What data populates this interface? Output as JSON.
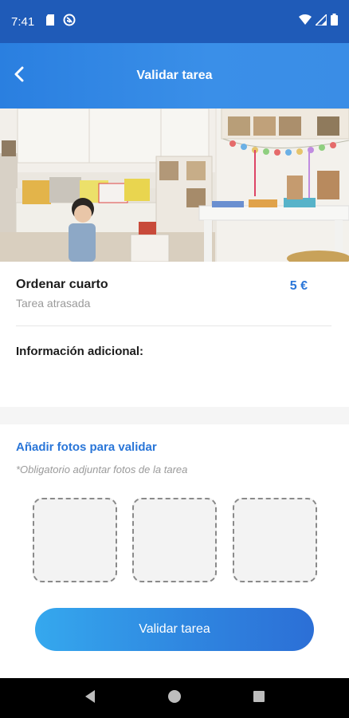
{
  "status_bar": {
    "time": "7:41",
    "left_icons": [
      "sd-card-icon",
      "no-tracking-icon"
    ],
    "right_icons": [
      "wifi-icon",
      "signal-icon",
      "battery-icon"
    ]
  },
  "app_bar": {
    "title": "Validar tarea",
    "back_icon": "chevron-left-icon"
  },
  "task": {
    "name": "Ordenar cuarto",
    "status": "Tarea atrasada",
    "price": "5 €",
    "additional_info_label": "Información adicional:"
  },
  "photos": {
    "title": "Añadir fotos para validar",
    "note": "*Obligatorio adjuntar fotos de la tarea",
    "slots": 3
  },
  "validate_button": {
    "label": "Validar tarea"
  },
  "colors": {
    "status_bar": "#1f5bb8",
    "app_bar": "#2a7fe0",
    "accent": "#2a76d8",
    "button_start": "#35a8ee",
    "button_end": "#2c6fd6"
  },
  "nav": {
    "icons": [
      "back-triangle-icon",
      "home-circle-icon",
      "recents-square-icon"
    ]
  }
}
